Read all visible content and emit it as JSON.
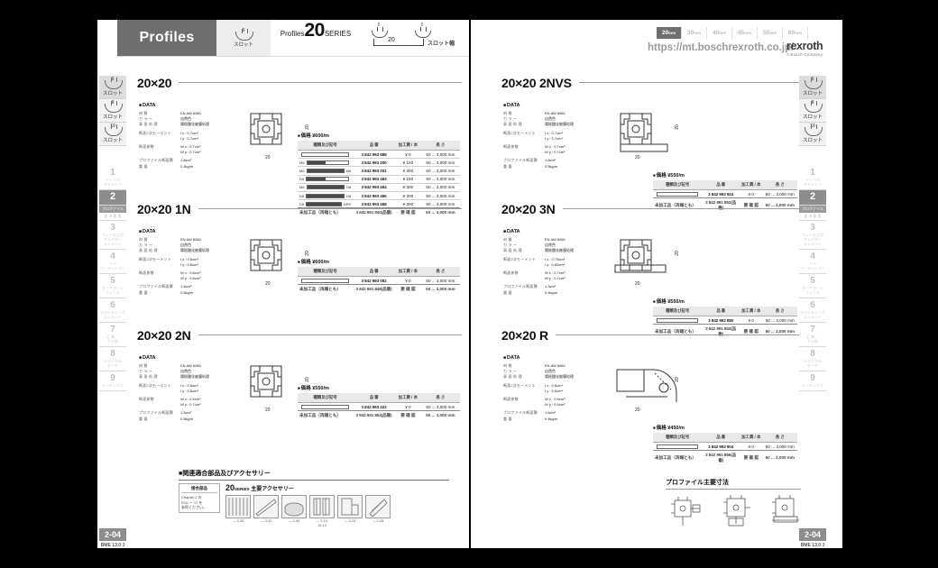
{
  "header": {
    "title": "Profiles",
    "slot_icon": {
      "num": "6",
      "label": "スロット",
      "name": "slot-cup-icon"
    },
    "series": {
      "prefix": "Profiles",
      "number": "20",
      "suffix": "SERIES"
    },
    "slot_width": {
      "left_num": "6",
      "right_num": "6",
      "dim": "20",
      "label": "スロット幅"
    },
    "sizes": [
      {
        "value": "20",
        "unit": "mm",
        "active": true
      },
      {
        "value": "30",
        "unit": "mm",
        "active": false
      },
      {
        "value": "40",
        "unit": "mm",
        "active": false
      },
      {
        "value": "45",
        "unit": "mm",
        "active": false
      },
      {
        "value": "50",
        "unit": "mm",
        "active": false
      },
      {
        "value": "60",
        "unit": "mm",
        "active": false
      }
    ],
    "url": "https://mt.boschrexroth.co.jp/",
    "logo": {
      "name": "rexroth",
      "tagline": "A Bosch Company"
    }
  },
  "sidebar": {
    "slot_tabs": [
      {
        "num": "6",
        "label": "スロット",
        "selected": true
      },
      {
        "num": "8",
        "label": "スロット",
        "selected": false
      },
      {
        "num": "10",
        "label": "スロット",
        "selected": false
      }
    ],
    "tabs": [
      {
        "num": "1",
        "label": "イントロ\nダクション",
        "active": false
      },
      {
        "num": "2",
        "label": "プロファイル\n基 本 要 素",
        "active": true
      },
      {
        "num": "3",
        "label": "フットおよび\nキャスター\nエレメント",
        "active": false
      },
      {
        "num": "4",
        "label": "ドア\nパーティション",
        "active": false
      },
      {
        "num": "5",
        "label": "セーフガード\nフェンス",
        "active": false
      },
      {
        "num": "6",
        "label": "スライディング\nエレメント",
        "active": false
      },
      {
        "num": "7",
        "label": "工 具 ・\nその他",
        "active": false
      },
      {
        "num": "8",
        "label": "テクニカル\nデータ",
        "active": false
      },
      {
        "num": "9",
        "label": "インデックス",
        "active": false
      }
    ],
    "page_number": "2-04",
    "doc_code": "BME 13.0 J"
  },
  "data_labels": {
    "title": "DATA",
    "keys": [
      "材 質",
      "カ ラ ー",
      "表 面 処 理",
      "断面2次モーメント",
      "",
      "断面係数",
      "",
      "プロファイル断面積",
      "重 量"
    ]
  },
  "sections": [
    {
      "id": "20x20",
      "title": "20×20",
      "column": "left",
      "data": {
        "material": "EN AW 6060",
        "color": "自然色",
        "surface": "陽極酸化被膜処理",
        "ix": "I x : 0.7cm⁴",
        "iy": "I y : 0.7cm⁴",
        "wx": "W x : 0.7cm³",
        "wy": "W y : 0.7cm³",
        "area": "1.6cm²",
        "weight": "0.4kg/m"
      },
      "dims": {
        "w": "20",
        "h": "20"
      },
      "table": {
        "caption": "価格 ¥600/m",
        "headers": [
          "種類及び記号",
          "品 番",
          "加工費 / 本",
          "長 さ"
        ],
        "rows": [
          {
            "sym": "",
            "tag": "",
            "part": "3 842 992 688",
            "price": "¥ 0",
            "len": "50 ... 3,000 mm"
          },
          {
            "sym": "half",
            "tag": "M6",
            "part": "3 842 993 200",
            "price": "¥ 150",
            "len": "50 ... 3,000 mm"
          },
          {
            "sym": "fill",
            "tag": "M6",
            "tag2": "M6",
            "part": "3 842 993 201",
            "price": "¥ 300",
            "len": "50 ... 3,000 mm"
          },
          {
            "sym": "half",
            "tag": "D8",
            "part": "3 842 993 463",
            "price": "¥ 150",
            "len": "50 ... 3,000 mm"
          },
          {
            "sym": "fill",
            "tag": "M6",
            "tag2": "D8",
            "part": "3 842 993 464",
            "price": "¥ 300",
            "len": "50 ... 3,000 mm"
          },
          {
            "sym": "fill",
            "tag": "D8",
            "tag2": "D8",
            "part": "3 842 993 465",
            "price": "¥ 300",
            "len": "50 ... 3,000 mm"
          },
          {
            "sym": "fill",
            "tag": "D8",
            "tag2": "DRV",
            "part": "3 842 993 466",
            "price": "¥ 300",
            "len": "50 ... 3,000 mm",
            "last": true
          }
        ],
        "footer": {
          "sym": "未加工品（両端とも）",
          "part": "3 842 991 840(品番)",
          "price": "要 確 認",
          "len": "50 ... 3,000 mm"
        }
      }
    },
    {
      "id": "20x20-1n",
      "title": "20×20 1N",
      "column": "left",
      "data": {
        "material": "EN AW 6060",
        "color": "自然色",
        "surface": "陽極酸化被膜処理",
        "ix": "I x : 0.6cm⁴",
        "iy": "I y : 0.6cm⁴",
        "wx": "W x : 0.6cm³",
        "wy": "W y : 0.6cm³",
        "area": "1.5cm²",
        "weight": "0.5kg/m"
      },
      "dims": {
        "w": "20",
        "h": "20"
      },
      "table": {
        "caption": "価格 ¥600/m",
        "headers": [
          "種類及び記号",
          "品 番",
          "加工費 / 本",
          "長 さ"
        ],
        "rows": [
          {
            "sym": "",
            "tag": "",
            "part": "3 842 993 082",
            "price": "¥ 0",
            "len": "50 ... 3,000 mm",
            "last": true
          }
        ],
        "footer": {
          "sym": "未加工品（両端とも）",
          "part": "3 842 991 848(品番)",
          "price": "要 確 認",
          "len": "50 ... 3,000 mm"
        }
      }
    },
    {
      "id": "20x20-2n",
      "title": "20×20 2N",
      "column": "left",
      "data": {
        "material": "EN AW 6060",
        "color": "自然色",
        "surface": "陽極酸化被膜処理",
        "ix": "I x : 0.6cm⁴",
        "iy": "I y : 0.6cm⁴",
        "wx": "W x : 0.5cm³",
        "wy": "W y : 0.7cm³",
        "area": "1.5cm²",
        "weight": "0.5kg/m"
      },
      "dims": {
        "w": "20",
        "h": "20"
      },
      "table": {
        "caption": "価格 ¥550/m",
        "headers": [
          "種類及び記号",
          "品 番",
          "加工費 / 本",
          "長 さ"
        ],
        "rows": [
          {
            "sym": "",
            "tag": "",
            "part": "3 842 993 422",
            "price": "¥ 0",
            "len": "50 ... 3,000 mm",
            "last": true
          }
        ],
        "footer": {
          "sym": "未加工品（両端とも）",
          "part": "3 842 991 854(品番)",
          "price": "要 確 認",
          "len": "50 ... 3,000 mm"
        }
      }
    },
    {
      "id": "20x20-2nvs",
      "title": "20×20 2NVS",
      "column": "right",
      "data": {
        "material": "EN AW 6060",
        "color": "自然色",
        "surface": "陽極酸化被膜処理",
        "ix": "I x : 0.7cm⁴",
        "iy": "I y : 0.7cm⁴",
        "wx": "W x : 0.7cm³",
        "wy": "W y : 0.7cm³",
        "area": "1.8cm²",
        "weight": "0.5kg/m"
      },
      "dims": {
        "w": "20",
        "h": "20"
      },
      "table": {
        "caption": "価格 ¥550/m",
        "headers": [
          "種類及び記号",
          "品 番",
          "加工費 / 本",
          "長 さ"
        ],
        "rows": [
          {
            "sym": "",
            "tag": "",
            "part": "3 842 992 924",
            "price": "¥ 0",
            "len": "50 ... 3,000 mm",
            "last": true
          }
        ],
        "footer": {
          "sym": "未加工品（両端とも）",
          "part": "3 842 991 852(品番)",
          "price": "要 確 認",
          "len": "50 ... 3,000 mm"
        }
      }
    },
    {
      "id": "20x20-3n",
      "title": "20×20 3N",
      "column": "right",
      "data": {
        "material": "EN AW 6060",
        "color": "自然色",
        "surface": "陽極酸化被膜処理",
        "ix": "I x : 0.70cm⁴",
        "iy": "I y : 0.60cm⁴",
        "wx": "W x : 0.7cm³",
        "wy": "W y : 0.7cm³",
        "area": "1.3cm²",
        "weight": "0.4kg/m"
      },
      "dims": {
        "w": "20",
        "h": "20"
      },
      "table": {
        "caption": "価格 ¥550/m",
        "headers": [
          "種類及び記号",
          "品 番",
          "加工費 / 本",
          "長 さ"
        ],
        "rows": [
          {
            "sym": "",
            "tag": "",
            "part": "3 842 992 880",
            "price": "¥ 0",
            "len": "50 ... 3,000 mm",
            "last": true
          }
        ],
        "footer": {
          "sym": "未加工品（両端とも）",
          "part": "3 842 991 852(品番)",
          "price": "要 確 認",
          "len": "50 ... 3,000 mm"
        }
      }
    },
    {
      "id": "20x20-r",
      "title": "20×20 R",
      "column": "right",
      "data": {
        "material": "EN AW 6060",
        "color": "自然色",
        "surface": "陽極酸化被膜処理",
        "ix": "I x : 0.6cm⁴",
        "iy": "I y : 0.6cm⁴",
        "wx": "W x : 0.5cm³",
        "wy": "W y : 0.5cm³",
        "area": "1.6cm²",
        "weight": "0.4kg/m"
      },
      "dims": {
        "w": "20",
        "h": "20"
      },
      "table": {
        "caption": "価格 ¥450/m",
        "headers": [
          "種類及び記号",
          "品 番",
          "加工費 / 本",
          "長 さ"
        ],
        "rows": [
          {
            "sym": "",
            "tag": "",
            "part": "3 842 992 904",
            "price": "¥ 0",
            "len": "50 ... 3,000 mm",
            "last": true
          }
        ],
        "footer": {
          "sym": "未加工品（両端とも）",
          "part": "3 842 991 856(品番)",
          "price": "要 確 認",
          "len": "50 ... 3,000 mm"
        }
      }
    }
  ],
  "bottom": {
    "accessories_title": "■関連適合部品及びアクセサリー",
    "chapter_box": {
      "heading": "接合部品",
      "body": "Chapter 2 の\nP.02 ～ 17 を\n参照ください。"
    },
    "acc_heading": {
      "num": "20",
      "series": "SERIES",
      "rest": "主要アクセサリー"
    },
    "acc_items": [
      {
        "caption": "→ 2-32",
        "thumb": "slot-covers"
      },
      {
        "caption": "→ 2-42",
        "thumb": "profile-bar"
      },
      {
        "caption": "→ 2-44",
        "thumb": "end-cap"
      },
      {
        "caption": "→ 2-13,\n15-19",
        "thumb": "connector-set"
      },
      {
        "caption": "→ 2-24",
        "thumb": "bracket"
      },
      {
        "caption": "→ 2-28",
        "thumb": "t-nut"
      }
    ],
    "dims_title": "プロファイル主要寸法"
  }
}
